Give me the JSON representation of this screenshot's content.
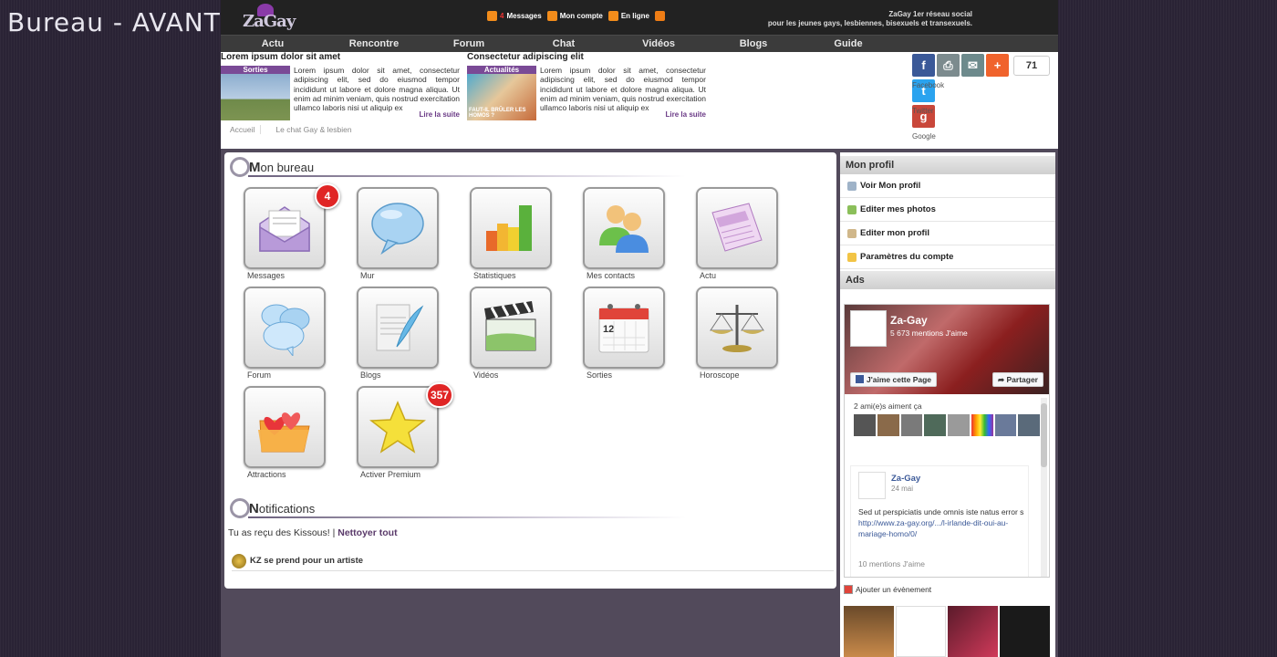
{
  "slide_title": "Bureau - AVANT",
  "header": {
    "logo_text": "ZaGay",
    "links": [
      {
        "label": "Messages",
        "count": "4"
      },
      {
        "label": "Mon compte"
      },
      {
        "label": "En ligne"
      }
    ],
    "tagline_line1": "ZaGay 1er réseau social",
    "tagline_line2": "pour les jeunes gays, lesbiennes, bisexuels et transexuels."
  },
  "nav": [
    "Actu",
    "Rencontre",
    "Forum",
    "Chat",
    "Vidéos",
    "Blogs",
    "Guide"
  ],
  "promos": [
    {
      "title": "Lorem ipsum dolor sit amet",
      "thumb_label": "Sorties",
      "thumb_caption": "",
      "text": "Lorem ipsum dolor sit amet, consectetur adipiscing elit, sed do eiusmod tempor incididunt ut labore et dolore magna aliqua. Ut enim ad minim veniam, quis nostrud exercitation ullamco laboris nisi ut aliquip ex",
      "read_more": "Lire la suite"
    },
    {
      "title": "Consectetur adipiscing elit",
      "thumb_label": "Actualités",
      "thumb_caption": "FAUT-IL BRÛLER LES HOMOS ?",
      "text": "Lorem ipsum dolor sit amet, consectetur adipiscing elit, sed do eiusmod tempor incididunt ut labore et dolore magna aliqua. Ut enim ad minim veniam, quis nostrud exercitation ullamco laboris nisi ut aliquip ex",
      "read_more": "Lire la suite"
    }
  ],
  "breadcrumb": [
    "Accueil",
    "Le chat Gay & lesbien"
  ],
  "share": {
    "count": "71",
    "labels": [
      "Facebook",
      "Twitter",
      "Google"
    ],
    "colors": {
      "facebook": "#3b5998",
      "print": "#7c8b8e",
      "email": "#6d8a8c",
      "plus": "#f0632c",
      "twitter": "#2aa3ef",
      "google": "#c9473a"
    }
  },
  "bureau": {
    "title_initial": "M",
    "title_rest": "on bureau",
    "tiles": [
      {
        "label": "Messages",
        "badge": "4",
        "icon": "envelope-icon"
      },
      {
        "label": "Mur",
        "badge": "",
        "icon": "speech-bubble-icon"
      },
      {
        "label": "Statistiques",
        "badge": "",
        "icon": "bar-chart-icon"
      },
      {
        "label": "Mes contacts",
        "badge": "",
        "icon": "contacts-icon"
      },
      {
        "label": "Actu",
        "badge": "",
        "icon": "newspaper-icon"
      },
      {
        "label": "Forum",
        "badge": "",
        "icon": "forum-bubbles-icon"
      },
      {
        "label": "Blogs",
        "badge": "",
        "icon": "blog-quill-icon"
      },
      {
        "label": "Vidéos",
        "badge": "",
        "icon": "clapperboard-icon"
      },
      {
        "label": "Sorties",
        "badge": "",
        "icon": "calendar-icon",
        "calendar_day": "12"
      },
      {
        "label": "Horoscope",
        "badge": "",
        "icon": "scales-icon"
      },
      {
        "label": "Attractions",
        "badge": "",
        "icon": "hearts-folder-icon"
      },
      {
        "label": "Activer Premium",
        "badge": "357",
        "icon": "star-icon"
      }
    ]
  },
  "notifications": {
    "title_initial": "N",
    "title_rest": "otifications",
    "text": "Tu as reçu des Kissous! |",
    "clear_all": "Nettoyer tout",
    "item": "KZ se prend pour un artiste"
  },
  "sidebar": {
    "profile_title": "Mon profil",
    "profile_items": [
      {
        "label": "Voir Mon profil",
        "icon": "profile-icon"
      },
      {
        "label": "Editer mes photos",
        "icon": "photo-edit-icon"
      },
      {
        "label": "Editer mon profil",
        "icon": "profile-edit-icon"
      },
      {
        "label": "Paramètres du compte",
        "icon": "folder-icon"
      }
    ],
    "ads_title": "Ads",
    "fb": {
      "page_name": "Za-Gay",
      "likes": "5 673 mentions J'aime",
      "like_btn": "J'aime cette Page",
      "share_btn": "Partager",
      "friends": "2 ami(e)s aiment ça",
      "post_name": "Za-Gay",
      "post_date": "24 mai",
      "post_text": "Sed ut perspiciatis unde omnis iste natus error s",
      "post_link": "http://www.za-gay.org/.../l-irlande-dit-oui-au-mariage-homo/0/",
      "post_mentions": "10 mentions J'aime"
    },
    "add_event": "Ajouter un évènement"
  }
}
